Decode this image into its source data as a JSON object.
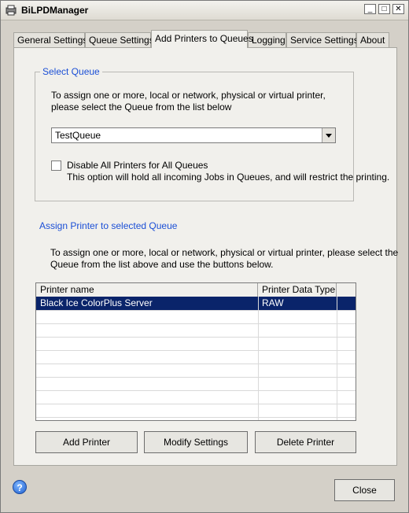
{
  "window": {
    "title": "BiLPDManager"
  },
  "tabs": [
    {
      "label": "General Settings"
    },
    {
      "label": "Queue Settings"
    },
    {
      "label": "Add Printers to Queues"
    },
    {
      "label": "Logging"
    },
    {
      "label": "Service Settings"
    },
    {
      "label": "About"
    }
  ],
  "select_queue": {
    "title": "Select Queue",
    "instruction_line1": "To assign one or more, local or network, physical or virtual printer,",
    "instruction_line2": "please select the Queue from the list below",
    "queue_value": "TestQueue",
    "disable_label": "Disable All Printers for All Queues",
    "disable_note": "This option will hold all incoming Jobs in Queues, and will restrict the printing.",
    "disable_checked": false
  },
  "assign": {
    "title": "Assign Printer to selected Queue",
    "instruction_line1": "To assign one or more, local or network, physical or virtual printer, please select the",
    "instruction_line2": "Queue from the list above and use the buttons below.",
    "columns": [
      "Printer name",
      "Printer Data Type"
    ],
    "rows": [
      {
        "name": "Black Ice ColorPlus Server",
        "type": "RAW"
      }
    ]
  },
  "buttons": {
    "add": "Add Printer",
    "modify": "Modify Settings",
    "delete": "Delete Printer",
    "close": "Close"
  }
}
